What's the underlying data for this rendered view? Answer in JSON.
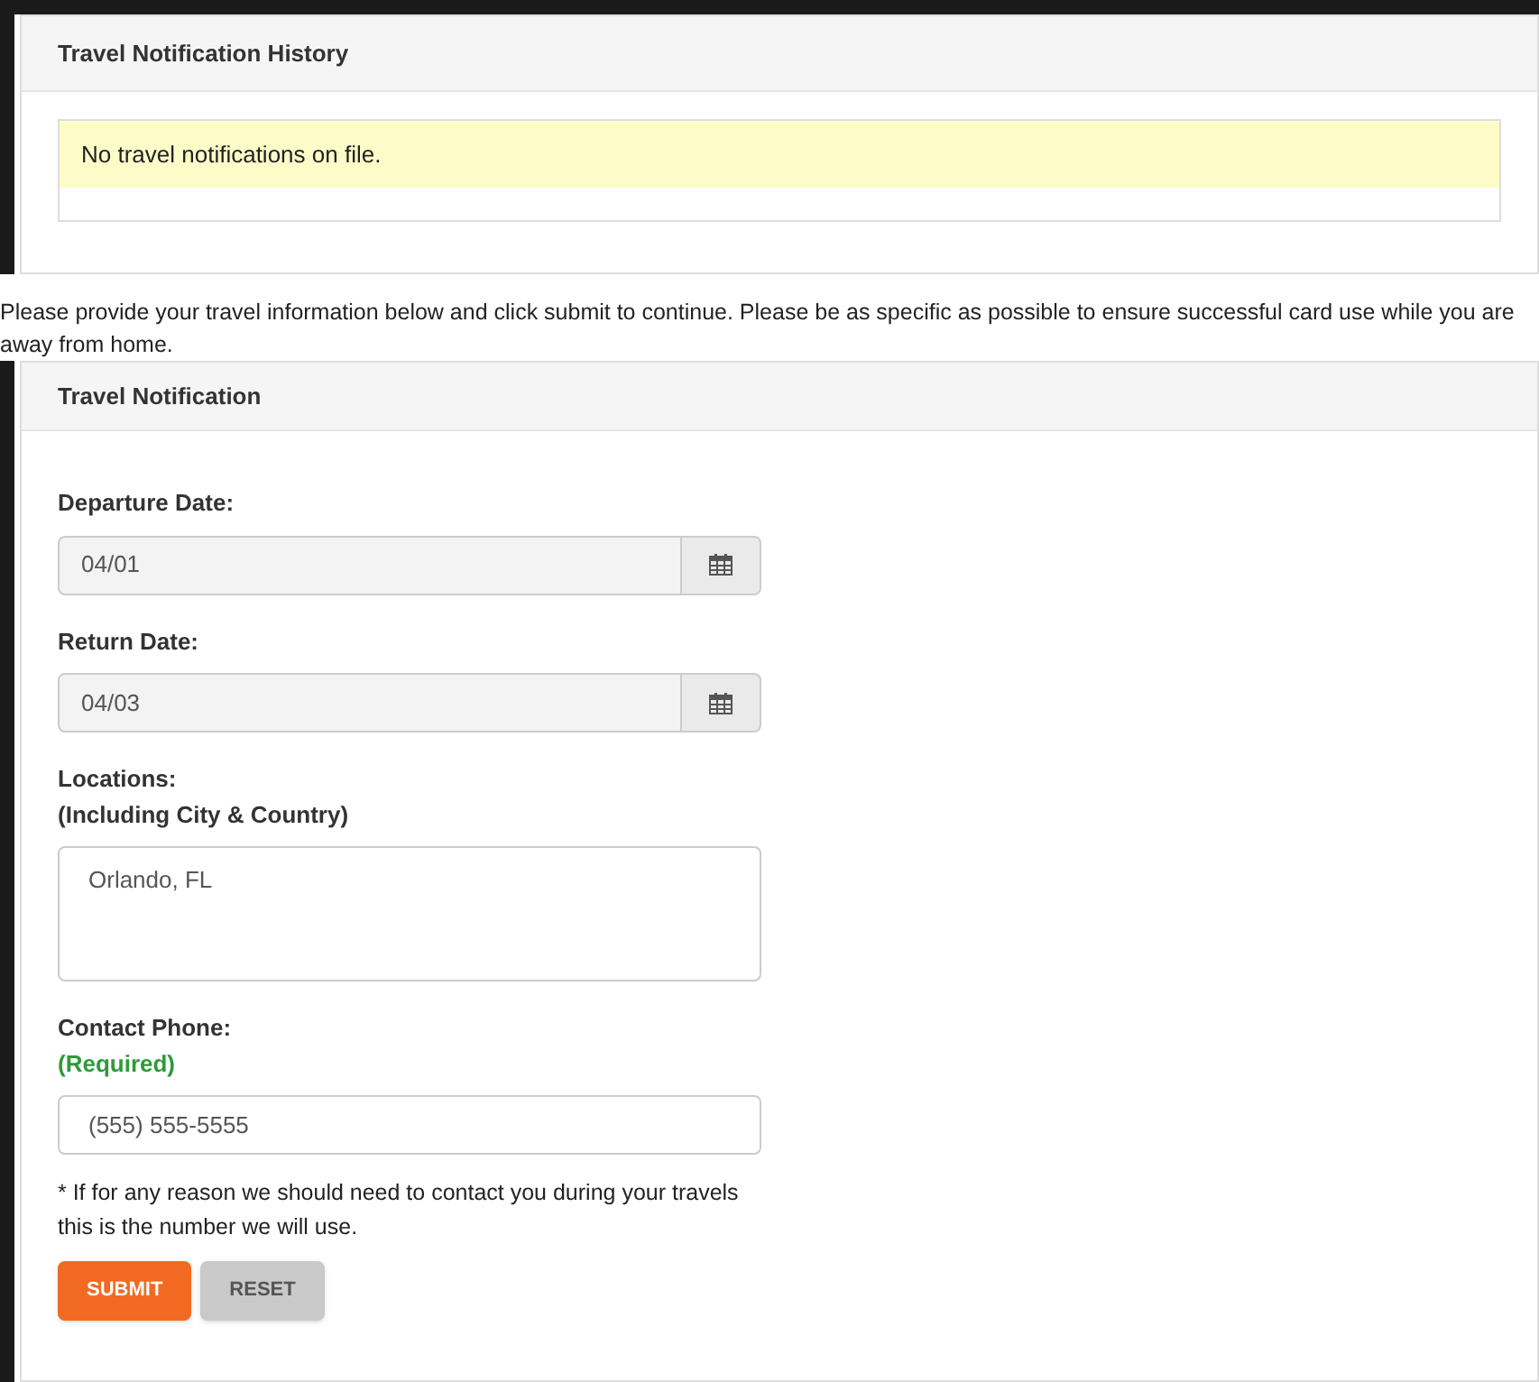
{
  "history": {
    "title": "Travel Notification History",
    "message": "No travel notifications on file."
  },
  "intro": "Please provide your travel information below and click submit to continue. Please be as specific as possible to ensure successful card use while you are away from home.",
  "form": {
    "title": "Travel Notification",
    "fields": [
      {
        "kind": "date",
        "label": "Departure Date:",
        "value": "04/01"
      },
      {
        "kind": "date",
        "label": "Return Date:",
        "value": "04/03"
      },
      {
        "kind": "textarea",
        "label": "Locations:",
        "sublabel": "(Including City & Country)",
        "value": "Orlando, FL"
      },
      {
        "kind": "text",
        "label": "Contact Phone:",
        "required": "(Required)",
        "value": "(555) 555-5555"
      }
    ],
    "note": "* If for any reason we should need to contact you during your travels this is the number we will use.",
    "buttons": [
      {
        "kind": "primary",
        "label": "SUBMIT"
      },
      {
        "kind": "secondary",
        "label": "RESET"
      }
    ]
  }
}
